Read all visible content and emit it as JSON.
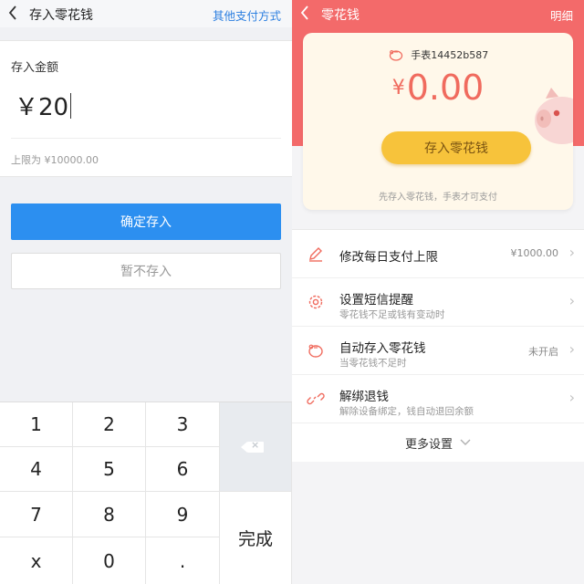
{
  "left": {
    "title": "存入零花钱",
    "other_payment": "其他支付方式",
    "amount_label": "存入金额",
    "amount_value": "￥20",
    "limit_text": "上限为 ¥10000.00",
    "confirm_button": "确定存入",
    "skip_button": "暂不存入",
    "keypad": {
      "k1": "1",
      "k2": "2",
      "k3": "3",
      "k4": "4",
      "k5": "5",
      "k6": "6",
      "k7": "7",
      "k8": "8",
      "k9": "9",
      "kx": "x",
      "k0": "0",
      "kdot": ".",
      "done": "完成"
    }
  },
  "right": {
    "title": "零花钱",
    "detail": "明细",
    "watch_name": "手表14452b587",
    "balance_symbol": "¥",
    "balance": "0.00",
    "deposit_button": "存入零花钱",
    "tip": "先存入零花钱，手表才可支付",
    "menu": [
      {
        "title": "修改每日支付上限",
        "subtitle": "",
        "value": "¥1000.00"
      },
      {
        "title": "设置短信提醒",
        "subtitle": "零花钱不足或钱有变动时",
        "value": ""
      },
      {
        "title": "自动存入零花钱",
        "subtitle": "当零花钱不足时",
        "value": "未开启"
      },
      {
        "title": "解绑退钱",
        "subtitle": "解除设备绑定，钱自动退回余额",
        "value": ""
      }
    ],
    "more_settings": "更多设置"
  },
  "colors": {
    "accent_blue": "#2c8ff0",
    "header_red": "#f36a6a",
    "amount_red": "#f06b5e",
    "button_yellow": "#f7c33b"
  }
}
